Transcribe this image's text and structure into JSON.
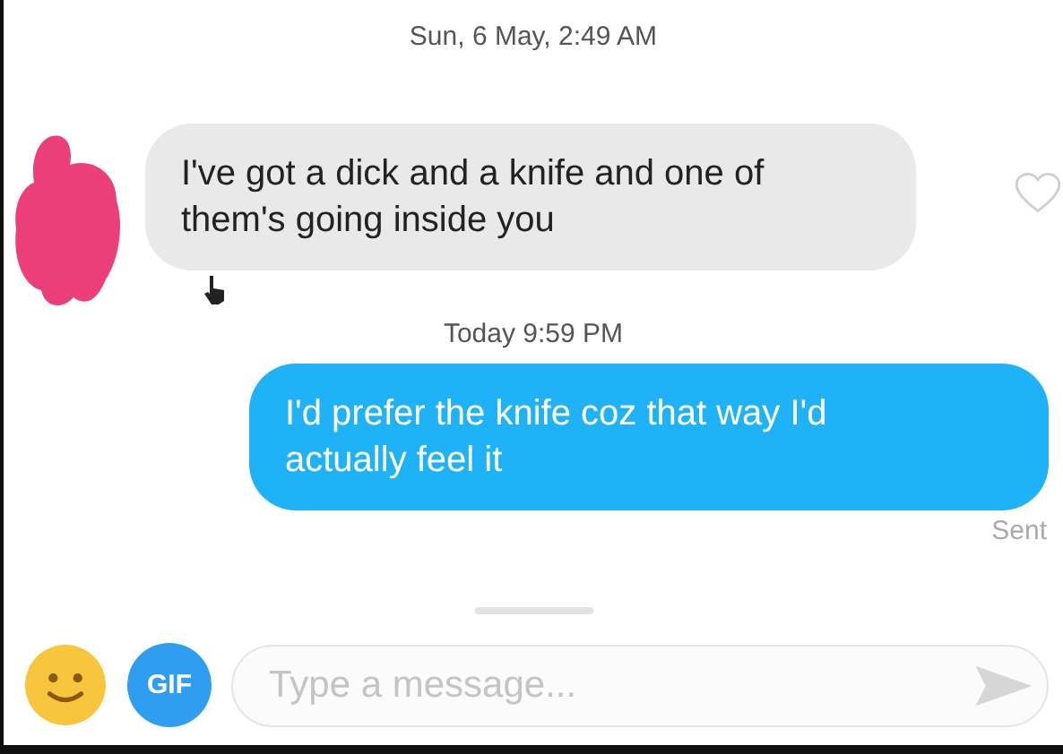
{
  "messages": [
    {
      "kind": "timestamp",
      "text": "Sun, 6 May, 2:49 AM"
    },
    {
      "kind": "incoming",
      "text": "I've got a dick and a knife and one of them's going inside you",
      "liked": false
    },
    {
      "kind": "timestamp",
      "text": "Today 9:59 PM"
    },
    {
      "kind": "outgoing",
      "text": "I'd prefer the knife coz that way I'd actually feel it"
    },
    {
      "kind": "status",
      "text": "Sent"
    }
  ],
  "composer": {
    "gif_label": "GIF",
    "placeholder": "Type a message..."
  }
}
